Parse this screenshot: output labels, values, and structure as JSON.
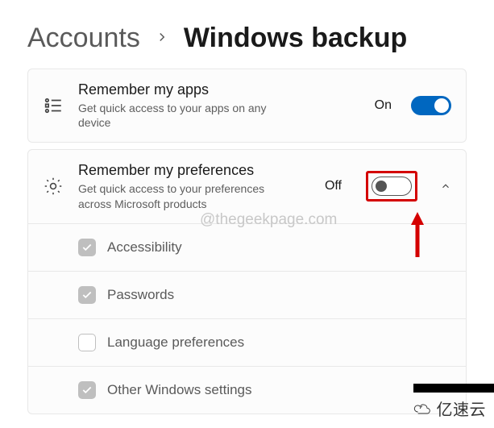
{
  "breadcrumb": {
    "parent": "Accounts",
    "current": "Windows backup"
  },
  "cards": {
    "apps": {
      "title": "Remember my apps",
      "desc": "Get quick access to your apps on any device",
      "state": "On"
    },
    "prefs": {
      "title": "Remember my preferences",
      "desc": "Get quick access to your preferences across Microsoft products",
      "state": "Off",
      "items": [
        {
          "label": "Accessibility",
          "checked": true
        },
        {
          "label": "Passwords",
          "checked": true
        },
        {
          "label": "Language preferences",
          "checked": false
        },
        {
          "label": "Other Windows settings",
          "checked": true
        }
      ]
    }
  },
  "watermark": "@thegeekpage.com",
  "brand": "亿速云"
}
